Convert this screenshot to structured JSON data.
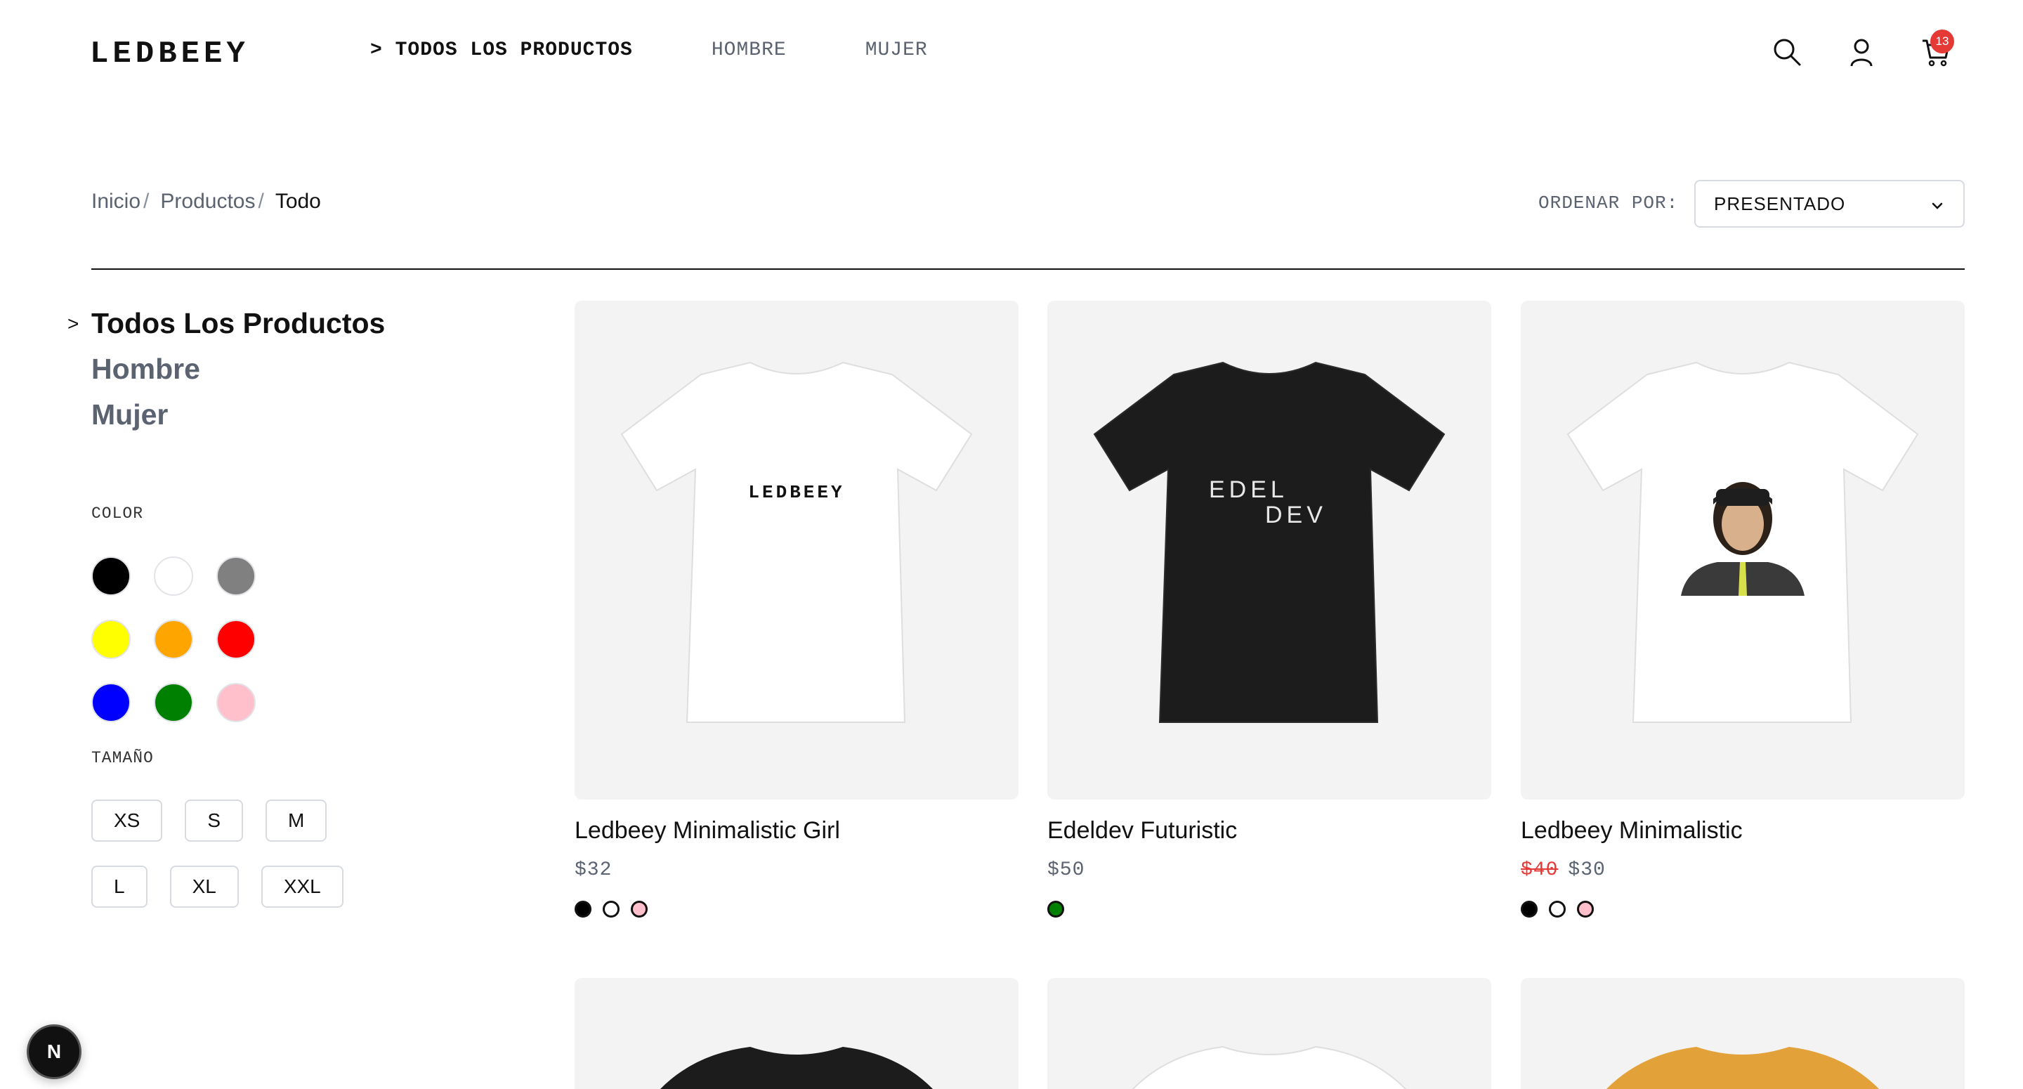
{
  "header": {
    "logo_text": "LEDBEEY",
    "nav": [
      {
        "label": "> TODOS LOS PRODUCTOS",
        "active": true
      },
      {
        "label": "HOMBRE",
        "active": false
      },
      {
        "label": "MUJER",
        "active": false
      }
    ],
    "icons": [
      "search-icon",
      "user-icon",
      "cart-icon"
    ],
    "cart_count": "13"
  },
  "breadcrumb": {
    "items": [
      "Inicio",
      "Productos",
      "Todo"
    ]
  },
  "sort": {
    "label": "ORDENAR POR:",
    "selected": "PRESENTADO"
  },
  "sidebar": {
    "categories": [
      {
        "label": "Todos Los Productos",
        "active": true,
        "marker": ">"
      },
      {
        "label": "Hombre",
        "active": false
      },
      {
        "label": "Mujer",
        "active": false
      }
    ],
    "color_title": "COLOR",
    "colors": [
      "#000000",
      "#ffffff",
      "#808080",
      "#ffff00",
      "#ffa500",
      "#ff0000",
      "#0000ff",
      "#008000",
      "#ffc0cb"
    ],
    "size_title": "TAMAÑO",
    "sizes": [
      "XS",
      "S",
      "M",
      "L",
      "XL",
      "XXL"
    ]
  },
  "products": [
    {
      "name": "Ledbeey Minimalistic Girl",
      "price": "$32",
      "old_price": "",
      "shirt_color": "#ffffff",
      "print_text": "LEDBEEY",
      "colors": [
        "#000000",
        "#ffffff",
        "#ffc0cb"
      ]
    },
    {
      "name": "Edeldev Futuristic",
      "price": "$50",
      "old_price": "",
      "shirt_color": "#1c1c1c",
      "print_text_1": "EDEL",
      "print_text_2": "DEV",
      "colors": [
        "#008000"
      ]
    },
    {
      "name": "Ledbeey Minimalistic",
      "price": "$30",
      "old_price": "$40",
      "shirt_color": "#ffffff",
      "colors": [
        "#000000",
        "#ffffff",
        "#ffc0cb"
      ]
    }
  ],
  "products_row2": [
    {
      "shirt_color": "#1c1c1c"
    },
    {
      "shirt_color": "#ffffff"
    },
    {
      "shirt_color": "#e3a13a"
    }
  ],
  "dev_badge": "N"
}
